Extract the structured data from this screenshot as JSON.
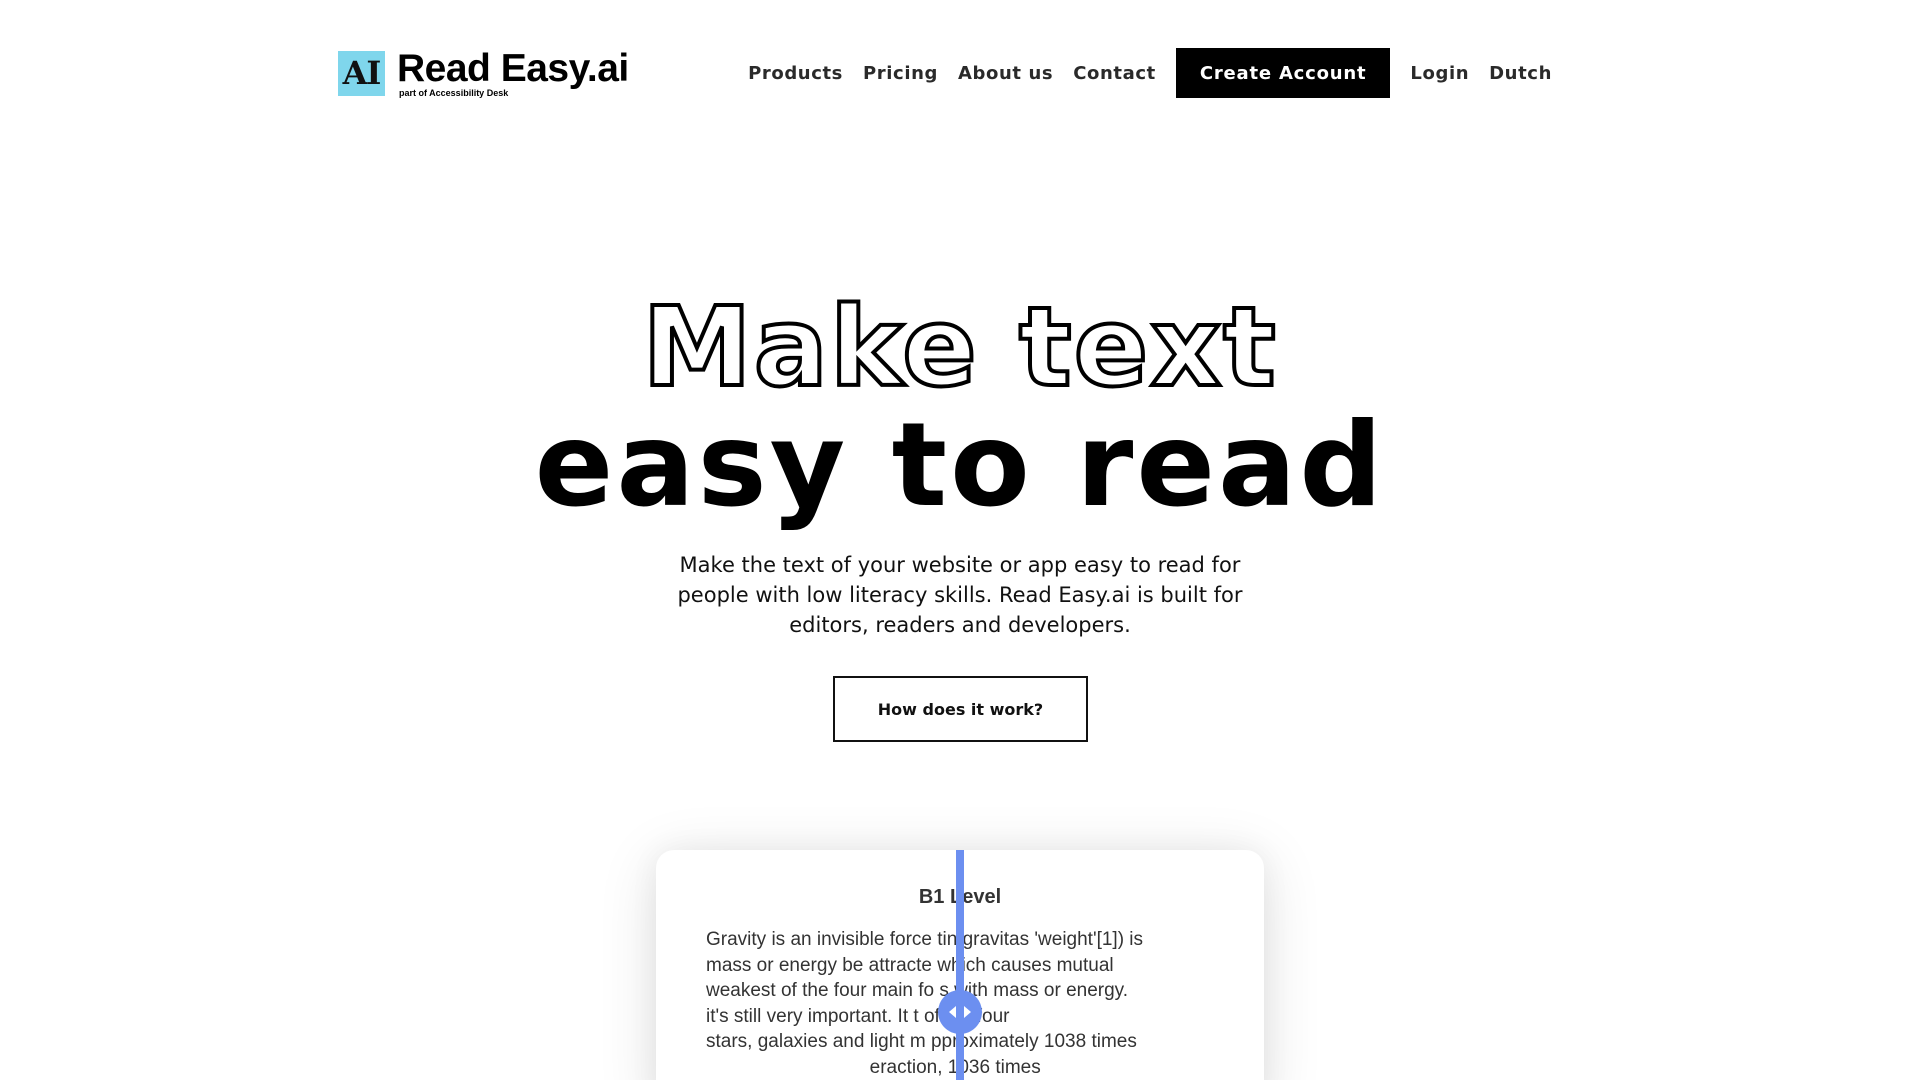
{
  "header": {
    "logo": {
      "mark": "AI",
      "name": "Read Easy.ai",
      "tagline": "part of Accessibility Desk"
    },
    "nav": {
      "products": "Products",
      "pricing": "Pricing",
      "about": "About us",
      "contact": "Contact",
      "create_account": "Create Account",
      "login": "Login",
      "language": "Dutch"
    }
  },
  "hero": {
    "line1": "Make text",
    "line2": "easy to read",
    "description": "Make the text of your website or app easy to read for people with low literacy skills. Read Easy.ai is built for editors, readers and developers.",
    "cta": "How does it work?"
  },
  "demo": {
    "title": "B1 Level",
    "lines": [
      "Gravity is an invisible force tin gravitas 'weight'[1]) is",
      "mass or energy be attracte which causes mutual",
      "weakest of the four main fo s with mass or energy.",
      "it's still very important. It t of the four",
      "stars, galaxies and light m pproximately 1038 times",
      "                               eraction, 1036 times"
    ]
  },
  "colors": {
    "logo_accent": "#7fd6ec",
    "slider_accent": "#6c8ff0",
    "cta_background": "#000000"
  }
}
